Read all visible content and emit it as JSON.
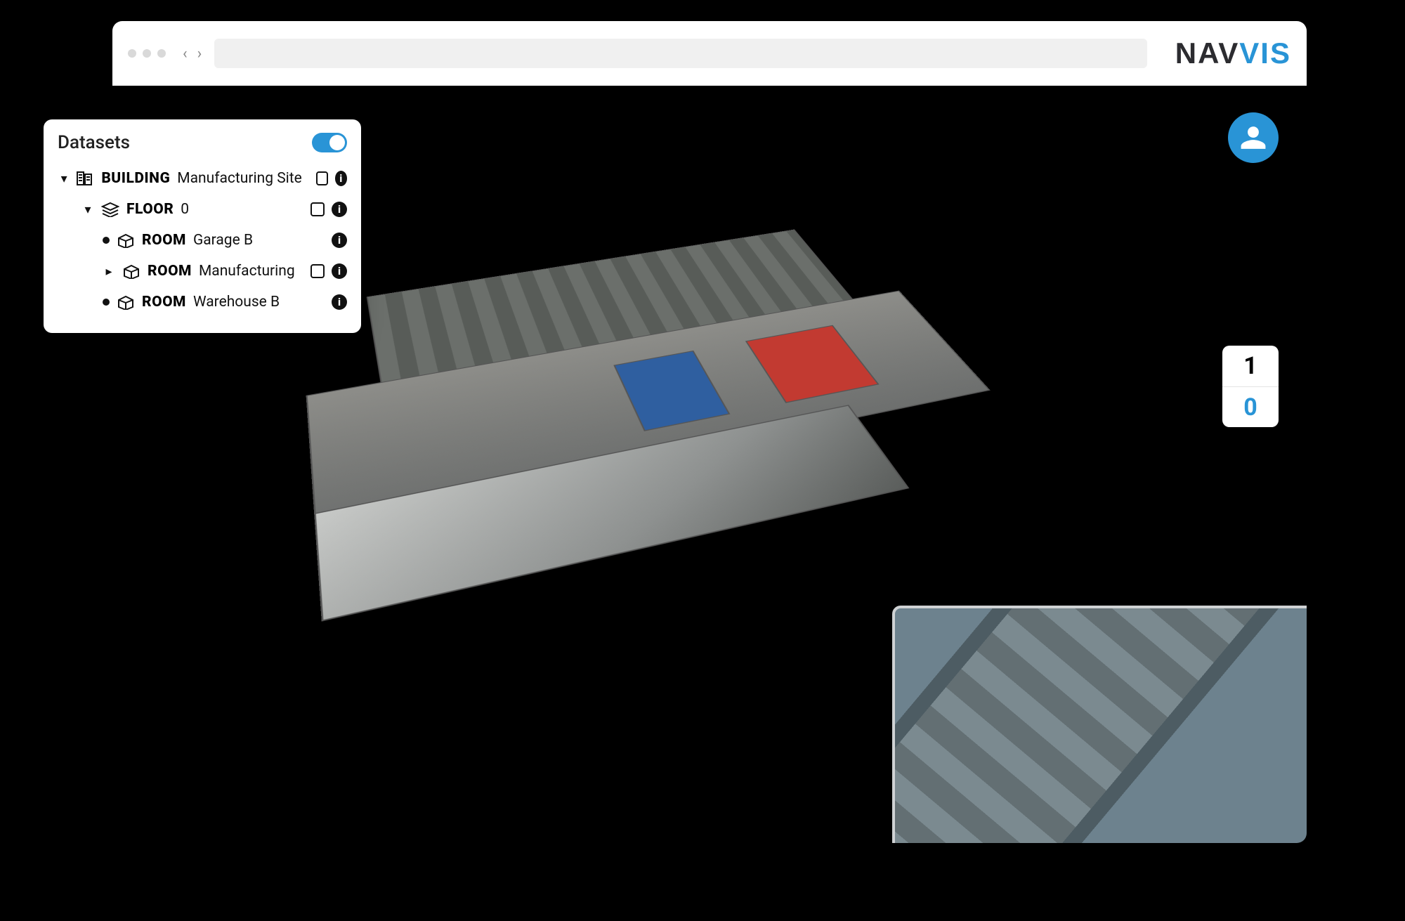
{
  "brand": {
    "part1": "NAV",
    "part2": "VIS"
  },
  "panel": {
    "title": "Datasets",
    "toggle_on": true,
    "tree": {
      "building": {
        "type": "BUILDING",
        "name": "Manufacturing Site"
      },
      "floor": {
        "type": "FLOOR",
        "name": "0"
      },
      "rooms": [
        {
          "type": "ROOM",
          "name": "Garage B",
          "expandable": false,
          "has_checkbox": false
        },
        {
          "type": "ROOM",
          "name": "Manufacturing",
          "expandable": true,
          "has_checkbox": true
        },
        {
          "type": "ROOM",
          "name": "Warehouse B",
          "expandable": false,
          "has_checkbox": false
        }
      ]
    }
  },
  "floor_selector": {
    "levels": [
      "1",
      "0"
    ],
    "active": "0"
  },
  "icons": {
    "account": "person-icon",
    "info_glyph": "i"
  }
}
